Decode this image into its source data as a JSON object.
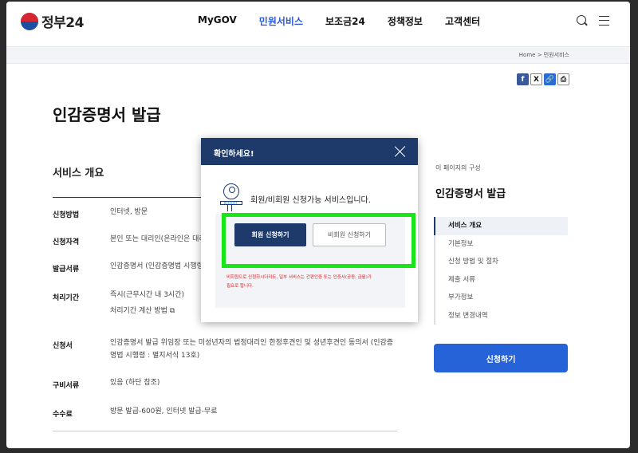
{
  "header": {
    "logo_text": "정부24",
    "nav": [
      "MyGOV",
      "민원서비스",
      "보조금24",
      "정책정보",
      "고객센터"
    ]
  },
  "breadcrumb": {
    "home": "Home",
    "sep": ">",
    "current": "민원서비스"
  },
  "share": {
    "fb": "f",
    "x": "X",
    "link": "🔗",
    "print": "⎙"
  },
  "page": {
    "title": "인감증명서 발급"
  },
  "overview": {
    "title": "서비스 개요",
    "rows": [
      {
        "label": "신청방법",
        "value": "인터넷, 방문"
      },
      {
        "label": "신청자격",
        "value": "본인 또는 대리인(온라인은 대리"
      },
      {
        "label": "발급서류",
        "value": "인감증명서 (인감증명법 시행령"
      },
      {
        "label": "처리기간",
        "value": "즉시(근무시간 내 3시간)",
        "value2": "처리기간 계산 방법 ⧉"
      },
      {
        "label": "신청서",
        "value": "인감증명서 발급 위임장 또는 미성년자의 법정대리인 한정후견인 및 성년후견인 동의서 (인감증",
        "value2": "명법 시행령 : 별지서식 13호)"
      },
      {
        "label": "구비서류",
        "value": "있음 (하단 참조)"
      },
      {
        "label": "수수료",
        "value": "방문 발급-600원, 인터넷 발급-무료"
      }
    ]
  },
  "sidebar": {
    "caption": "이 페이지의 구성",
    "title": "인감증명서 발급",
    "items": [
      "서비스 개요",
      "기본정보",
      "신청 방법 및 절차",
      "제출 서류",
      "부가정보",
      "정보 변경내역"
    ],
    "apply_label": "신청하기"
  },
  "modal": {
    "title": "확인하세요!",
    "message": "회원/비회원 신청가능 서비스입니다.",
    "member_btn": "회원 신청하기",
    "nonmember_btn": "비회원 신청하기",
    "warning_1": "비회원으로 신청하시더라도, 일부 서비스는 간편인증 또는 인증서(공동, 금융)가",
    "warning_2": "필요로 합니다."
  }
}
